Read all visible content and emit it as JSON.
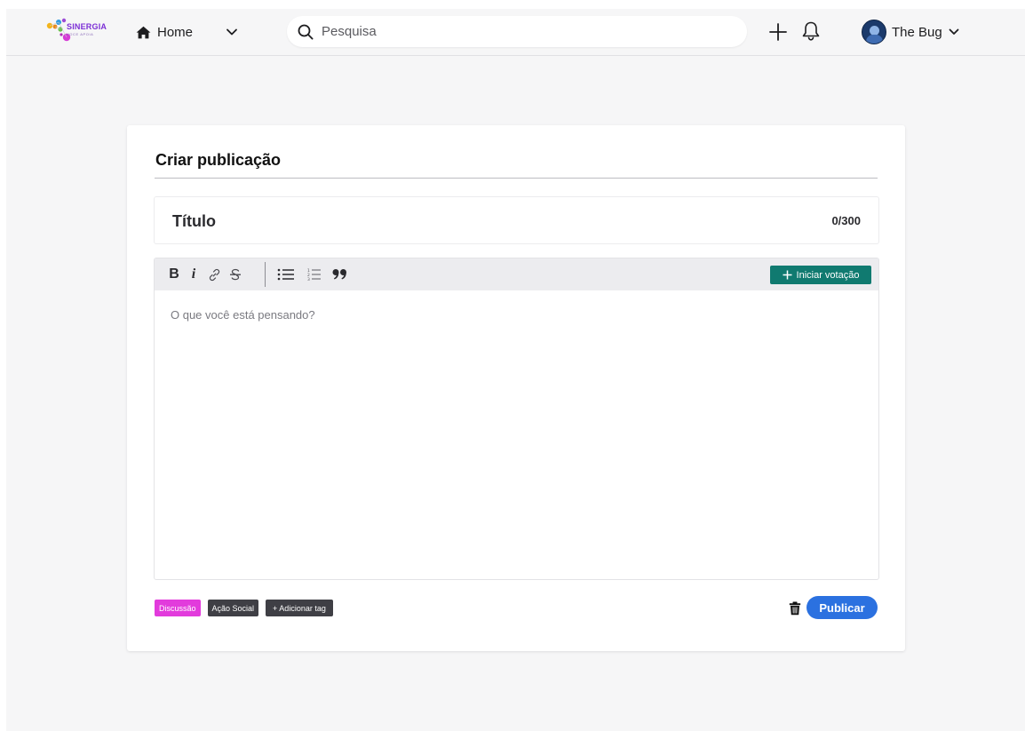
{
  "header": {
    "logo": {
      "name": "SINERGIA",
      "tagline": "VOCE APOIA"
    },
    "home_label": "Home",
    "search_placeholder": "Pesquisa",
    "user_name": "The Bug"
  },
  "post_form": {
    "heading": "Criar publicação",
    "title_placeholder": "Título",
    "char_count": "0/300",
    "body_placeholder": "O que você está pensando?",
    "toolbar": {
      "bold_label": "B",
      "italic_label": "i",
      "vote_button_label": "Iniciar votação"
    },
    "tags": [
      {
        "label": "Discussão",
        "color": "#e23bdc"
      },
      {
        "label": "Ação Social",
        "color": "#3f3f45"
      },
      {
        "label": "+ Adicionar tag",
        "color": "#3f3f45"
      }
    ],
    "publish_label": "Publicar"
  },
  "colors": {
    "accent_blue": "#2b71e0",
    "vote_teal": "#107a70",
    "tag_magenta": "#e23bdc",
    "tag_dark": "#3f3f45"
  },
  "icons": [
    "home-icon",
    "chevron-down-icon",
    "search-icon",
    "plus-icon",
    "bell-icon",
    "bold-icon",
    "italic-icon",
    "link-icon",
    "strikethrough-icon",
    "bullet-list-icon",
    "numbered-list-icon",
    "quote-icon",
    "trash-icon"
  ]
}
